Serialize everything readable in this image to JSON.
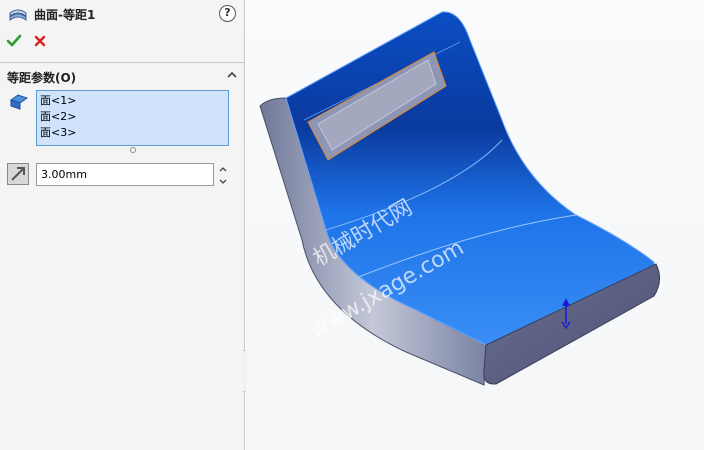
{
  "property_manager": {
    "title": "曲面-等距1",
    "help_icon": "?",
    "ok_icon": "check-icon",
    "cancel_icon": "close-icon"
  },
  "offset_group": {
    "title": "等距参数(O)",
    "faces": [
      "面<1>",
      "面<2>",
      "面<3>"
    ],
    "distance_value": "3.00mm"
  },
  "viewport": {
    "watermark_cn": "机械时代网",
    "watermark_url": "www.jxage.com",
    "colors": {
      "surface_blue": "#1e73e8",
      "edge_gray": "#9aa0b4",
      "background": "#f7f8fa"
    }
  }
}
